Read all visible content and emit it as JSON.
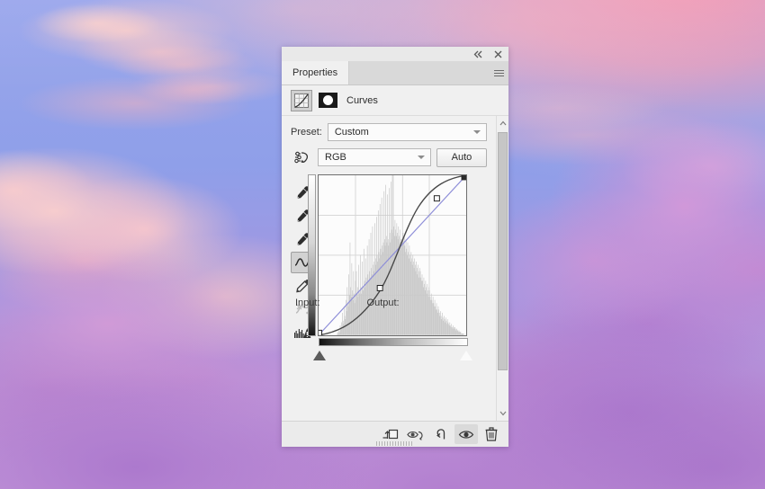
{
  "background": {
    "name": "sunset-clouds-photo",
    "sky_color": "#93a2ea",
    "cloud_pink": "#f5b4c0",
    "cloud_purple": "#aa76cc",
    "pink_glow": "#f796af"
  },
  "panel": {
    "titlebar": {
      "collapse_label": "«",
      "close_label": "✕"
    },
    "tabs": [
      {
        "label": "Properties",
        "active": true
      }
    ],
    "menu_icon": "hamburger-menu-icon",
    "header": {
      "adjustment_icon": "curves-adjustment-icon",
      "mask_thumbnail_icon": "layer-mask-thumbnail",
      "title": "Curves"
    },
    "preset": {
      "label": "Preset:",
      "value": "Custom",
      "caret_icon": "chevron-down-icon"
    },
    "channel": {
      "target_adjust_icon": "targeted-adjustment-tool-icon",
      "value": "RGB",
      "caret_icon": "chevron-down-icon",
      "auto_label": "Auto"
    },
    "tools": [
      {
        "name": "black-point-eyedropper",
        "icon": "eyedropper-icon",
        "active": false,
        "disabled": false
      },
      {
        "name": "gray-point-eyedropper",
        "icon": "eyedropper-icon",
        "active": false,
        "disabled": false
      },
      {
        "name": "white-point-eyedropper",
        "icon": "eyedropper-icon",
        "active": false,
        "disabled": false
      },
      {
        "name": "edit-points-curve-tool",
        "icon": "curve-icon",
        "active": true,
        "disabled": false
      },
      {
        "name": "pencil-draw-curve-tool",
        "icon": "pencil-icon",
        "active": false,
        "disabled": false
      },
      {
        "name": "smooth-curve-tool",
        "icon": "smooth-curve-icon",
        "active": false,
        "disabled": true
      },
      {
        "name": "histogram-display-options",
        "icon": "histogram-warning-icon",
        "active": false,
        "disabled": false
      }
    ],
    "graph": {
      "input_label": "Input:",
      "output_label": "Output:",
      "input_value": "",
      "output_value": "",
      "black_point_marker": "black-point-slider",
      "white_point_marker": "white-point-slider"
    },
    "scrollbar": {
      "up_icon": "chevron-up-icon",
      "down_icon": "chevron-down-icon"
    },
    "footer_buttons": [
      {
        "name": "clip-to-layer-button",
        "icon": "clip-to-layer-icon",
        "active": false
      },
      {
        "name": "toggle-previous-state-button",
        "icon": "eye-arrow-icon",
        "active": false
      },
      {
        "name": "reset-adjustment-button",
        "icon": "reset-arrow-icon",
        "active": false
      },
      {
        "name": "toggle-layer-visibility-button",
        "icon": "eye-icon",
        "active": true
      },
      {
        "name": "delete-adjustment-layer-button",
        "icon": "trash-icon",
        "active": false
      }
    ],
    "resize_grip": "panel-resize-grip"
  },
  "chart_data": {
    "type": "line",
    "title": "Curves — RGB tone curve",
    "xlabel": "Input",
    "ylabel": "Output",
    "xlim": [
      0,
      255
    ],
    "ylim": [
      0,
      255
    ],
    "grid": true,
    "grid_divisions": 4,
    "series": [
      {
        "name": "baseline-diagonal",
        "color": "#8e8ed8",
        "points": [
          [
            0,
            0
          ],
          [
            255,
            255
          ]
        ]
      },
      {
        "name": "rgb-curve",
        "color": "#474747",
        "control_points": [
          [
            0,
            0
          ],
          [
            110,
            72
          ],
          [
            205,
            215
          ],
          [
            255,
            255
          ]
        ],
        "shape": "s-curve-darkened-shadows"
      }
    ],
    "histogram": {
      "color": "#c9c9c9",
      "bins": [
        0,
        0,
        0,
        0,
        0,
        0,
        0,
        0,
        0,
        0,
        0,
        0,
        0,
        0,
        0,
        0,
        0,
        0,
        0,
        0,
        0,
        0,
        0,
        0,
        0,
        0,
        0,
        0,
        0,
        0,
        0,
        0,
        1,
        2,
        1,
        3,
        2,
        6,
        4,
        8,
        5,
        14,
        9,
        7,
        18,
        12,
        10,
        22,
        15,
        30,
        20,
        18,
        38,
        25,
        58,
        30,
        24,
        45,
        28,
        22,
        40,
        26,
        20,
        34,
        22,
        40,
        26,
        30,
        24,
        44,
        28,
        26,
        50,
        30,
        26,
        46,
        30,
        28,
        54,
        34,
        30,
        48,
        36,
        32,
        56,
        38,
        34,
        60,
        40,
        36,
        64,
        42,
        38,
        68,
        44,
        40,
        46,
        70,
        44,
        48,
        74,
        50,
        46,
        78,
        52,
        48,
        82,
        54,
        50,
        86,
        56,
        52,
        58,
        90,
        60,
        56,
        94,
        62,
        58,
        88,
        60,
        56,
        92,
        64,
        58,
        96,
        66,
        60,
        64,
        100,
        68,
        62,
        72,
        66,
        62,
        70,
        64,
        60,
        68,
        62,
        58,
        66,
        60,
        56,
        60,
        100,
        64,
        58,
        62,
        56,
        52,
        60,
        54,
        50,
        58,
        52,
        48,
        56,
        50,
        46,
        52,
        48,
        44,
        50,
        46,
        42,
        48,
        44,
        40,
        46,
        42,
        38,
        44,
        40,
        36,
        42,
        40,
        36,
        34,
        38,
        34,
        30,
        36,
        32,
        28,
        34,
        30,
        26,
        32,
        28,
        24,
        30,
        28,
        24,
        22,
        26,
        22,
        20,
        24,
        20,
        18,
        22,
        18,
        16,
        20,
        16,
        14,
        18,
        16,
        14,
        12,
        15,
        12,
        10,
        14,
        11,
        9,
        12,
        10,
        8,
        11,
        9,
        7,
        10,
        8,
        7,
        6,
        8,
        6,
        5,
        7,
        5,
        4,
        6,
        5,
        4,
        5,
        4,
        3,
        4,
        3,
        3,
        2,
        3,
        2,
        2,
        2,
        1,
        1,
        1,
        1,
        1,
        0,
        0,
        0,
        0
      ],
      "peaks_at": [
        54,
        113,
        145,
        161
      ]
    }
  }
}
